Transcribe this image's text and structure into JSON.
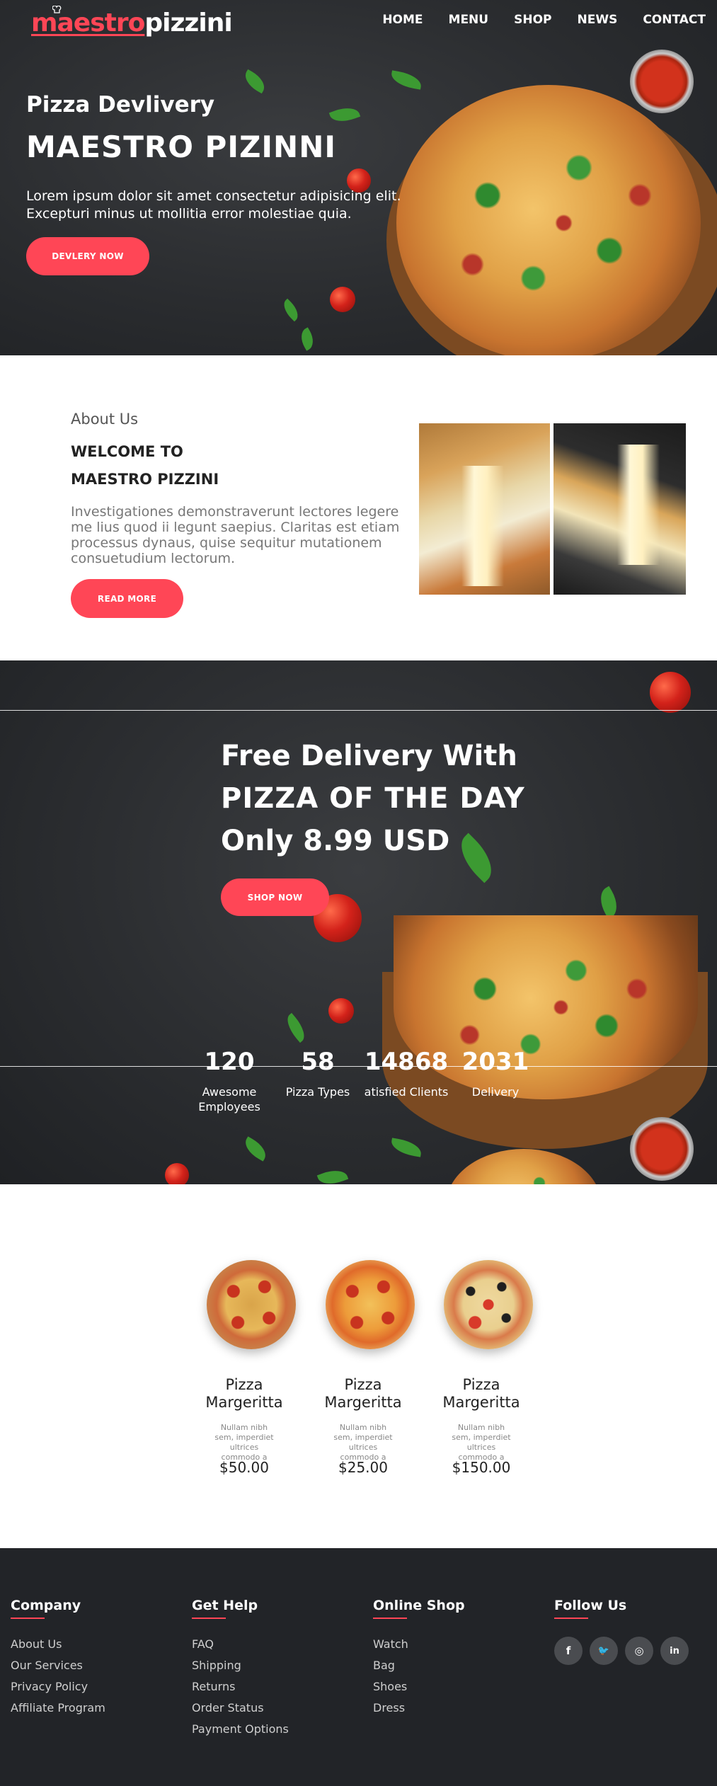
{
  "brand": {
    "part1": "maestro",
    "part2": "pizzini",
    "accent": "#ff4656"
  },
  "nav": [
    "HOME",
    "MENU",
    "SHOP",
    "NEWS",
    "CONTACT"
  ],
  "hero": {
    "subtitle": "Pizza Devlivery",
    "title": "MAESTRO PIZINNI",
    "description": "Lorem ipsum dolor sit amet consectetur adipisicing elit. Excepturi minus ut mollitia error molestiae quia.",
    "button": "DEVLERY NOW"
  },
  "about": {
    "heading": "About Us",
    "welcome": "WELCOME TO",
    "name": "MAESTRO PIZZINI",
    "text": "Investigationes demonstraverunt lectores legere me lius quod ii legunt saepius. Claritas est etiam processus dynaus, quise sequitur mutationem consuetudium lectorum.",
    "button": "READ MORE"
  },
  "promo": {
    "line1": "Free Delivery With",
    "line2": "PIZZA OF THE DAY",
    "line3": "Only 8.99 USD",
    "button": "SHOP NOW"
  },
  "stats": [
    {
      "number": "120",
      "label": "Awesome Employees"
    },
    {
      "number": "58",
      "label": "Pizza Types"
    },
    {
      "number": "14868",
      "label": "atisfied Clients"
    },
    {
      "number": "2031",
      "label": "Delivery"
    }
  ],
  "products": [
    {
      "name": "Pizza Margeritta",
      "desc": "Nullam nibh sem, imperdiet ultrices commodo a",
      "price": "$50.00"
    },
    {
      "name": "Pizza Margeritta",
      "desc": "Nullam nibh sem, imperdiet ultrices commodo a",
      "price": "$25.00"
    },
    {
      "name": "Pizza Margeritta",
      "desc": "Nullam nibh sem, imperdiet ultrices commodo a",
      "price": "$150.00"
    }
  ],
  "footer": {
    "columns": [
      {
        "title": "Company",
        "links": [
          "About Us",
          "Our Services",
          "Privacy Policy",
          "Affiliate Program"
        ]
      },
      {
        "title": "Get Help",
        "links": [
          "FAQ",
          "Shipping",
          "Returns",
          "Order Status",
          "Payment Options"
        ]
      },
      {
        "title": "Online Shop",
        "links": [
          "Watch",
          "Bag",
          "Shoes",
          "Dress"
        ]
      },
      {
        "title": "Follow Us",
        "links": []
      }
    ],
    "social": [
      {
        "icon": "facebook-icon",
        "glyph": "f"
      },
      {
        "icon": "twitter-icon",
        "glyph": "🐦"
      },
      {
        "icon": "instagram-icon",
        "glyph": "◎"
      },
      {
        "icon": "linkedin-icon",
        "glyph": "in"
      }
    ]
  }
}
